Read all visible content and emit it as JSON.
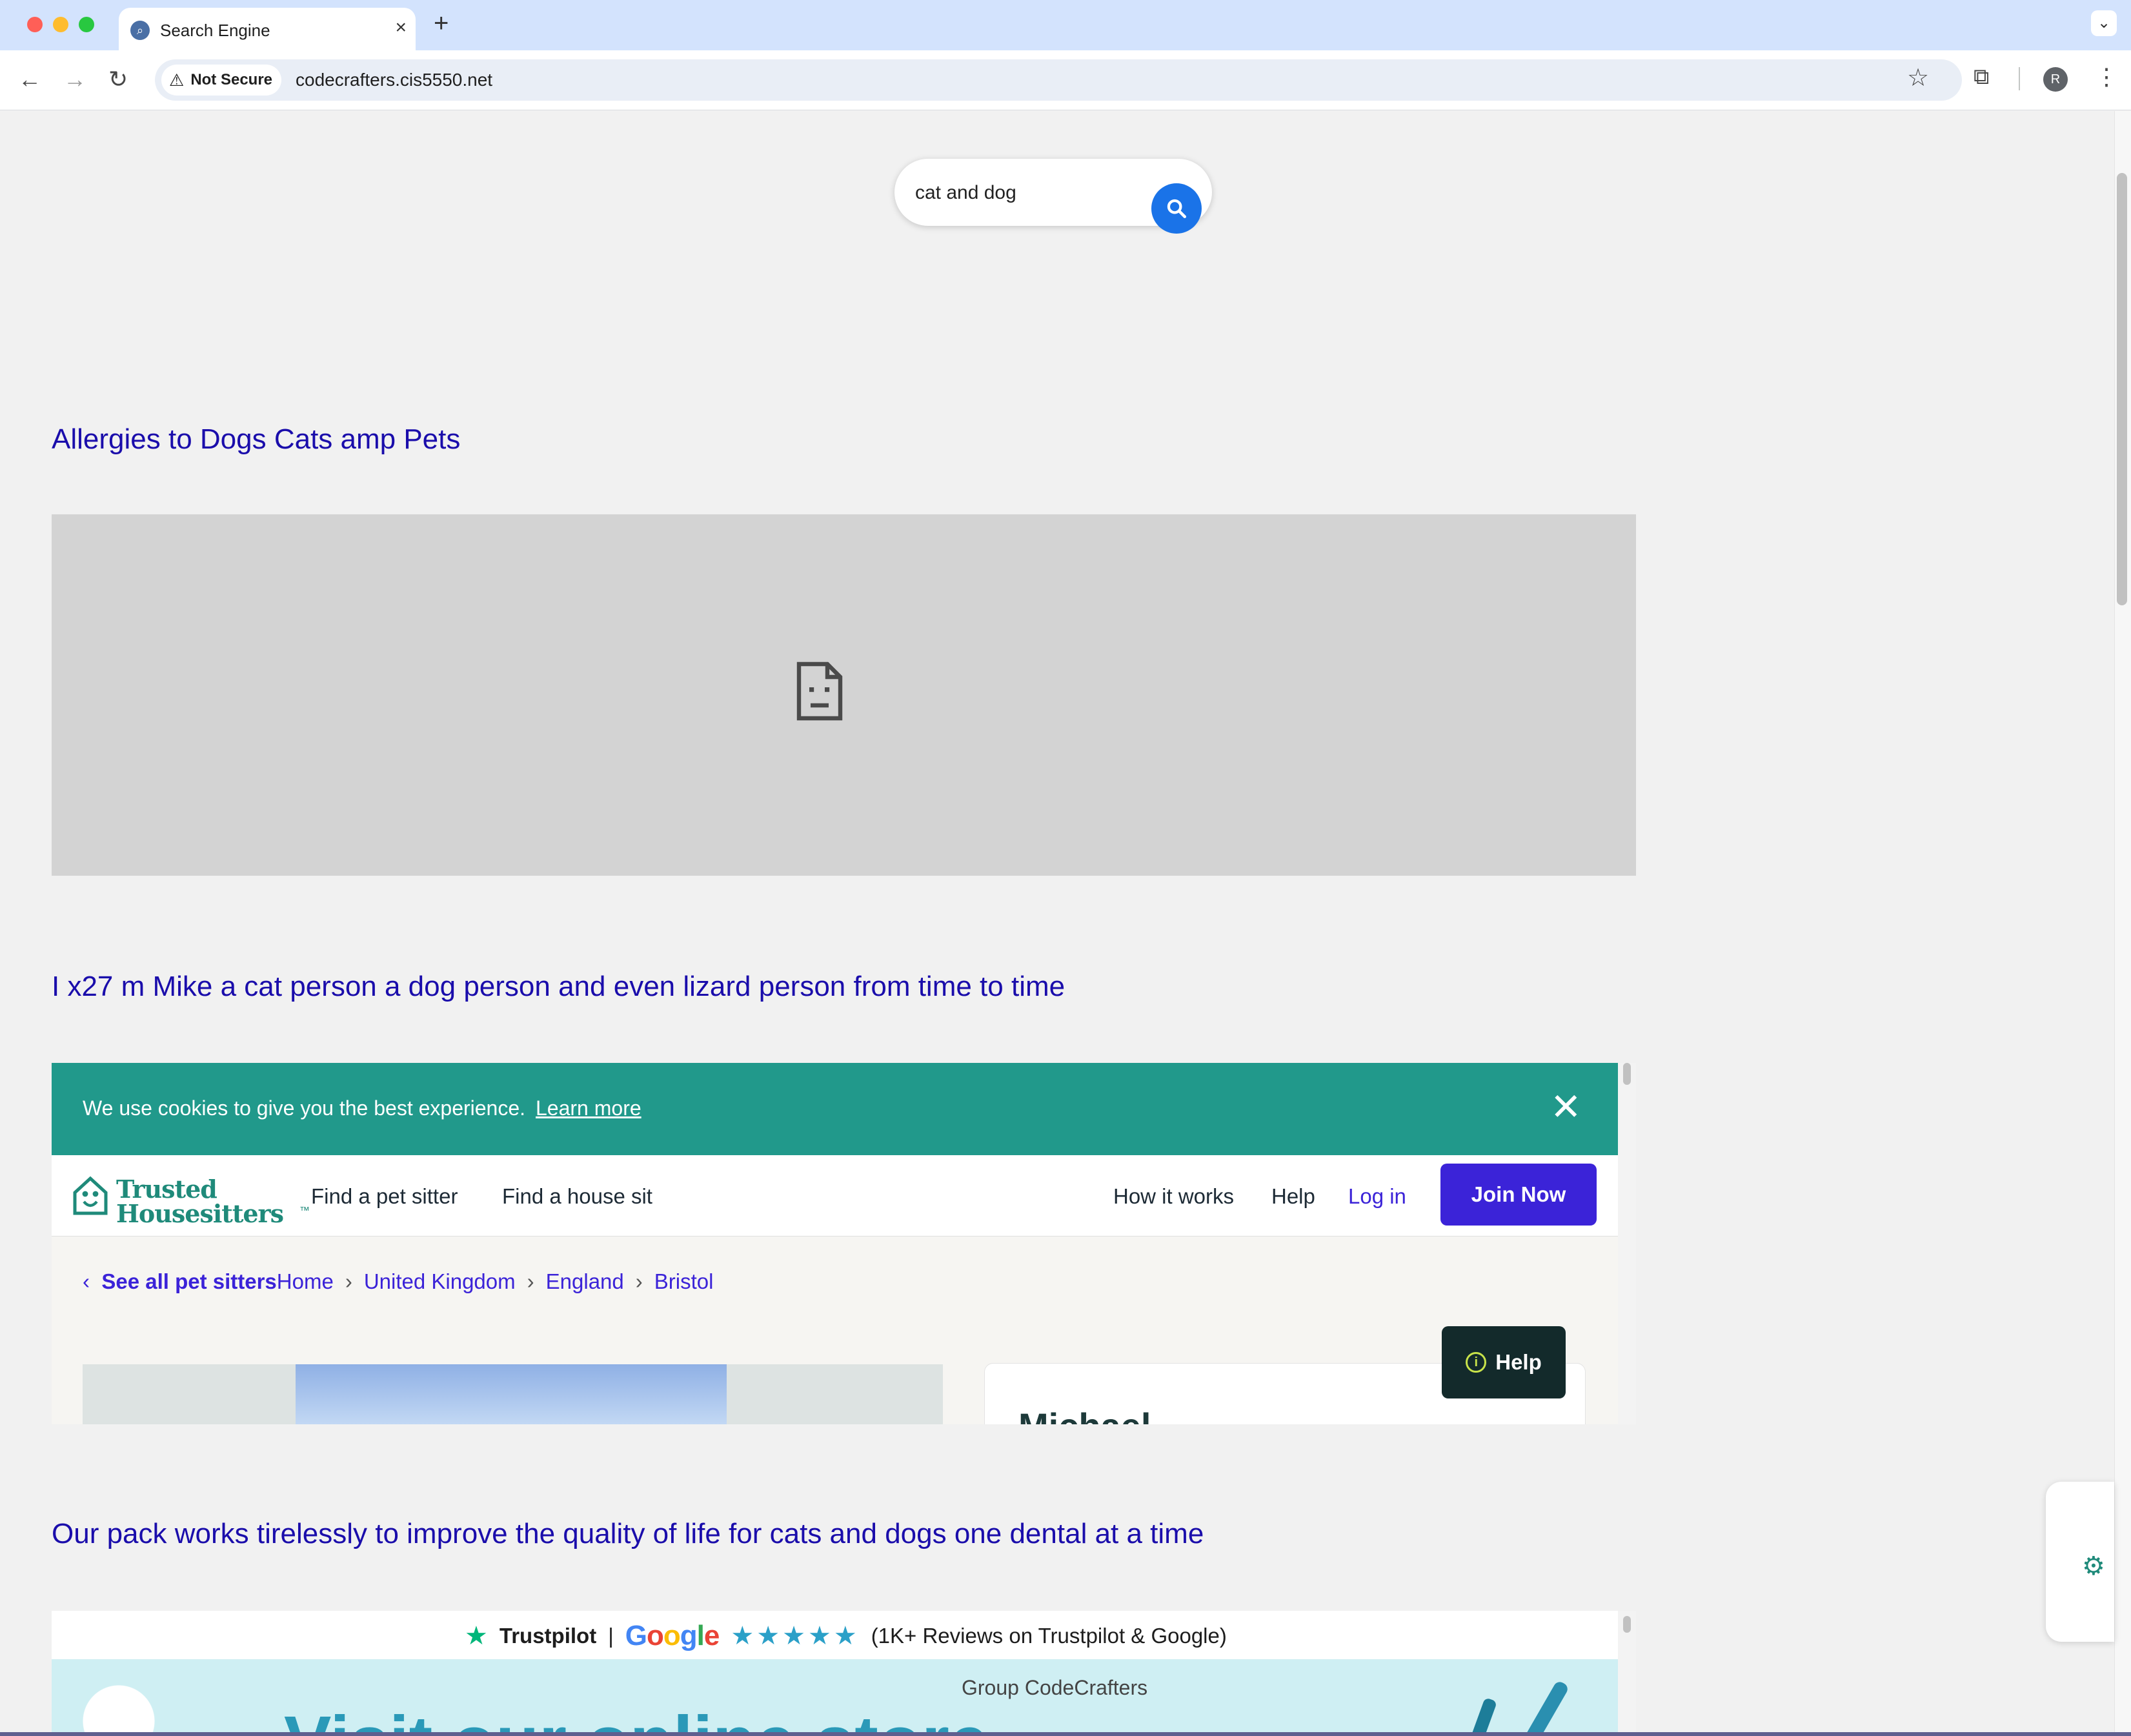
{
  "browser": {
    "tab_title": "Search Engine",
    "tab_close": "×",
    "new_tab": "+",
    "security_label": "Not Secure",
    "url": "codecrafters.cis5550.net",
    "profile_initial": "R"
  },
  "search": {
    "query": "cat and dog"
  },
  "results": [
    {
      "title": "Allergies to Dogs Cats amp Pets"
    },
    {
      "title": "I x27 m Mike a cat person a dog person and even lizard person from time to time"
    },
    {
      "title": "Our pack works tirelessly to improve the quality of life for cats and dogs one dental at a time"
    }
  ],
  "frame2": {
    "cookie_text": "We use cookies to give you the best experience.",
    "cookie_link": "Learn more",
    "logo_line1": "Trusted",
    "logo_line2": "Housesitters",
    "logo_tm": "™",
    "nav": {
      "find_sitter": "Find a pet sitter",
      "find_house": "Find a house sit",
      "how_it_works": "How it works",
      "help": "Help",
      "login": "Log in",
      "join": "Join Now"
    },
    "breadcrumbs": {
      "back": "See all pet sitters",
      "items": [
        "Home",
        "United Kingdom",
        "England",
        "Bristol"
      ]
    },
    "help_bubble": "Help",
    "sitter_name": "Michael"
  },
  "frame3": {
    "trustpilot": "Trustpilot",
    "separator": "|",
    "google_letters": [
      "G",
      "o",
      "o",
      "g",
      "l",
      "e"
    ],
    "google_colors": [
      "#4285f4",
      "#ea4335",
      "#fbbc05",
      "#4285f4",
      "#34a853",
      "#ea4335"
    ],
    "stars": "★★★★★",
    "reviews": "(1K+ Reviews on Trustpilot & Google)",
    "group": "Group CodeCrafters",
    "headline": "Visit our online store"
  },
  "colors": {
    "link": "#1a0dab",
    "search_button": "#1a73e8",
    "cookie_bar": "#21998b",
    "join_button": "#3b23d8"
  }
}
